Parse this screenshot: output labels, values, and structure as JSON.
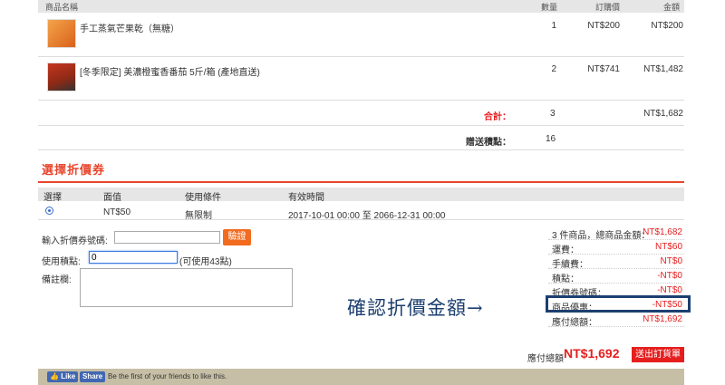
{
  "table_header": {
    "name": "商品名稱",
    "qty": "數量",
    "price": "訂購價",
    "amount": "金額"
  },
  "items": [
    {
      "name": "手工蒸氣芒果乾（無糖）",
      "qty": "1",
      "price": "NT$200",
      "amount": "NT$200"
    },
    {
      "name": "[冬季限定] 美濃橙蜜香番茄 5斤/箱 (產地直送)",
      "qty": "2",
      "price": "NT$741",
      "amount": "NT$1,482"
    }
  ],
  "totals": {
    "subtotal_label": "合計：",
    "subtotal_qty": "3",
    "subtotal_amount": "NT$1,682",
    "points_label": "贈送積點：",
    "points_value": "16"
  },
  "coupon": {
    "section_title": "選擇折價券",
    "headers": {
      "select": "選擇",
      "value": "面值",
      "condition": "使用條件",
      "period": "有效時間"
    },
    "row": {
      "value": "NT$50",
      "condition": "無限制",
      "period": "2017-10-01 00:00 至 2066-12-31 00:00"
    }
  },
  "form": {
    "coupon_code_label": "輸入折價券號碼:",
    "coupon_code_value": "",
    "verify_button": "驗證",
    "points_label": "使用積點:",
    "points_value": "0",
    "points_hint": "(可使用43點)",
    "note_label": "備註欄:"
  },
  "summary": [
    {
      "label": "3 件商品，總商品金額：",
      "value": "NT$1,682"
    },
    {
      "label": "運費：",
      "value": "NT$60"
    },
    {
      "label": "手續費：",
      "value": "NT$0"
    },
    {
      "label": "積點：",
      "value": "-NT$0"
    },
    {
      "label": "折價券號碼：",
      "value": "-NT$0"
    },
    {
      "label": "商品優惠：",
      "value": "-NT$50"
    },
    {
      "label": "應付總額：",
      "value": "NT$1,692"
    }
  ],
  "annotation": "確認折價金額→",
  "footer": {
    "total_label": "應付總額",
    "total_value": "NT$1,692",
    "submit_button": "送出訂貨單"
  },
  "facebook": {
    "like": "Like",
    "share": "Share",
    "text": "Be the first of your friends to like this."
  },
  "colors": {
    "accent_red": "#e61e1e",
    "orange": "#f26b1f",
    "annotation_blue": "#1c3f70"
  }
}
